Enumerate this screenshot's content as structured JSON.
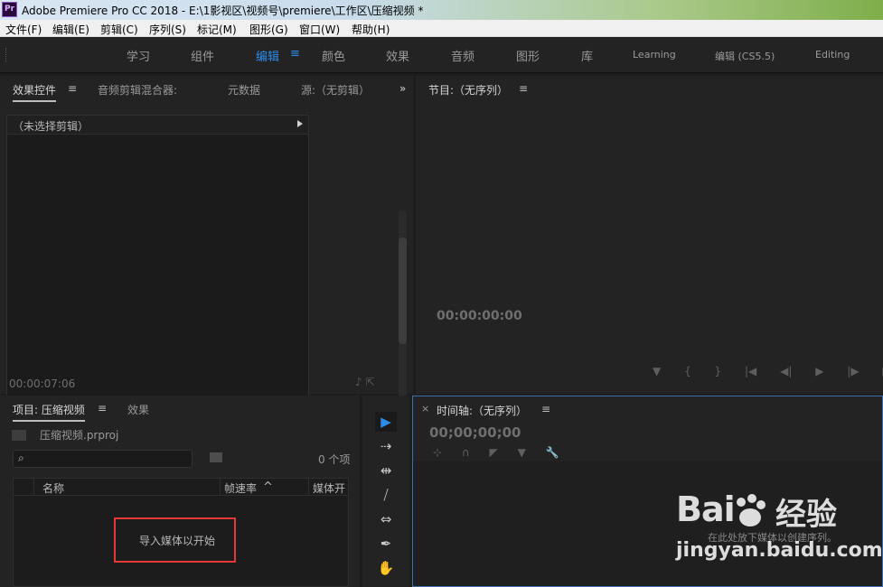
{
  "window": {
    "icon_text": "Pr",
    "title": "Adobe Premiere Pro CC 2018 - E:\\1影视区\\视频号\\premiere\\工作区\\压缩视频 *"
  },
  "menubar": [
    "文件(F)",
    "编辑(E)",
    "剪辑(C)",
    "序列(S)",
    "标记(M)",
    "图形(G)",
    "窗口(W)",
    "帮助(H)"
  ],
  "workspaces": {
    "tabs": [
      "学习",
      "组件",
      "编辑",
      "颜色",
      "效果",
      "音频",
      "图形",
      "库",
      "Learning",
      "编辑 (CS5.5)",
      "Editing"
    ],
    "active": "编辑",
    "menu_glyph": "≡"
  },
  "effect_controls": {
    "tabs": [
      "效果控件",
      "音频剪辑混合器:",
      "元数据",
      "源:（无剪辑）"
    ],
    "menu_glyph": "≡",
    "overflow_glyph": "»",
    "no_clip": "（未选择剪辑）",
    "timecode": "00:00:07:06",
    "footer_icons": "♪ ⇱"
  },
  "program": {
    "title": "节目:（无序列）",
    "menu_glyph": "≡",
    "timecode": "00:00:00:00",
    "controls": [
      "▼",
      "{",
      "}",
      "|◀",
      "◀|",
      "▶",
      "|▶",
      "▶|"
    ]
  },
  "project": {
    "tabs": [
      "项目: 压缩视频",
      "效果"
    ],
    "menu_glyph": "≡",
    "file": "压缩视频.prproj",
    "search_glyph": "⌕",
    "count": "0 个项",
    "columns": [
      "名称",
      "帧速率",
      "媒体开"
    ],
    "sort_glyph": "^",
    "empty_message": "导入媒体以开始"
  },
  "tools": [
    "▶",
    "⇢",
    "⇹",
    "⧸",
    "⇔",
    "✒",
    "✋"
  ],
  "timeline": {
    "close": "×",
    "title": "时间轴:（无序列）",
    "menu_glyph": "≡",
    "timecode": "00;00;00;00",
    "tools": [
      "⊹",
      "∩",
      "◤",
      "▼",
      "🔧"
    ],
    "drop_hint": "在此处放下媒体以创建序列。"
  },
  "watermark": {
    "logo": "Bai",
    "text": "经验",
    "url": "jingyan.baidu.com"
  }
}
